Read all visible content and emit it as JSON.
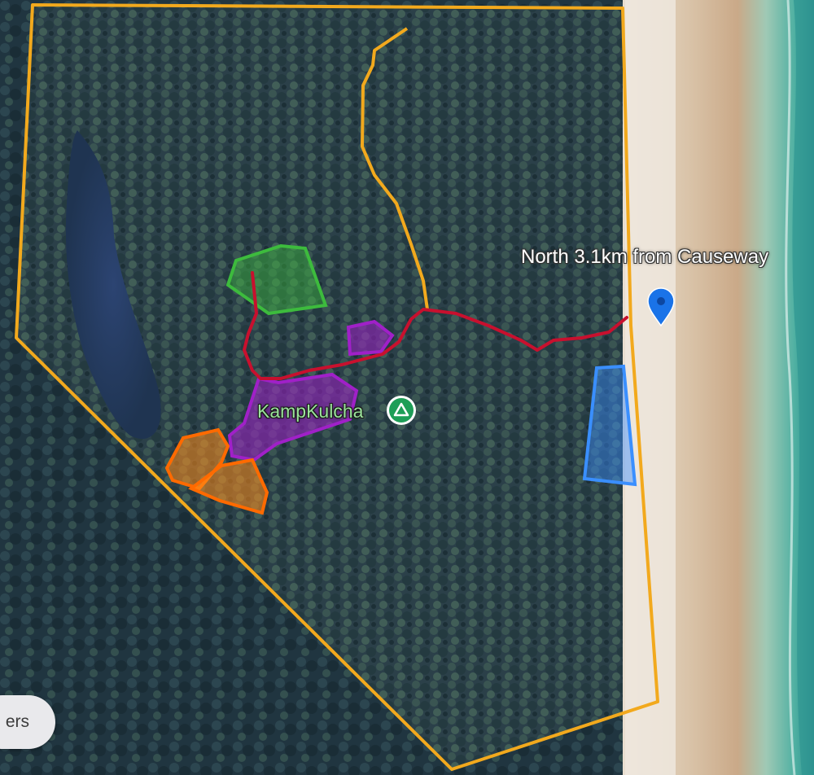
{
  "map": {
    "type": "satellite",
    "colors": {
      "boundary": "#f2a91d",
      "track": "#c8102e",
      "access_path": "#f2a91d",
      "zone_green": "#3dbb3d",
      "zone_purple": "#a020c8",
      "zone_orange": "#ff8c1a",
      "zone_blue": "#3a8fff",
      "pin": "#1a73e8",
      "camp_icon": "#1e9e57"
    }
  },
  "markers": {
    "causeway_label": "North 3.1km from Causeway",
    "camp_label": "KampKulcha",
    "camp_icon": "campground-icon",
    "pin_icon": "location-pin-icon"
  },
  "controls": {
    "layers_label": "ers"
  }
}
